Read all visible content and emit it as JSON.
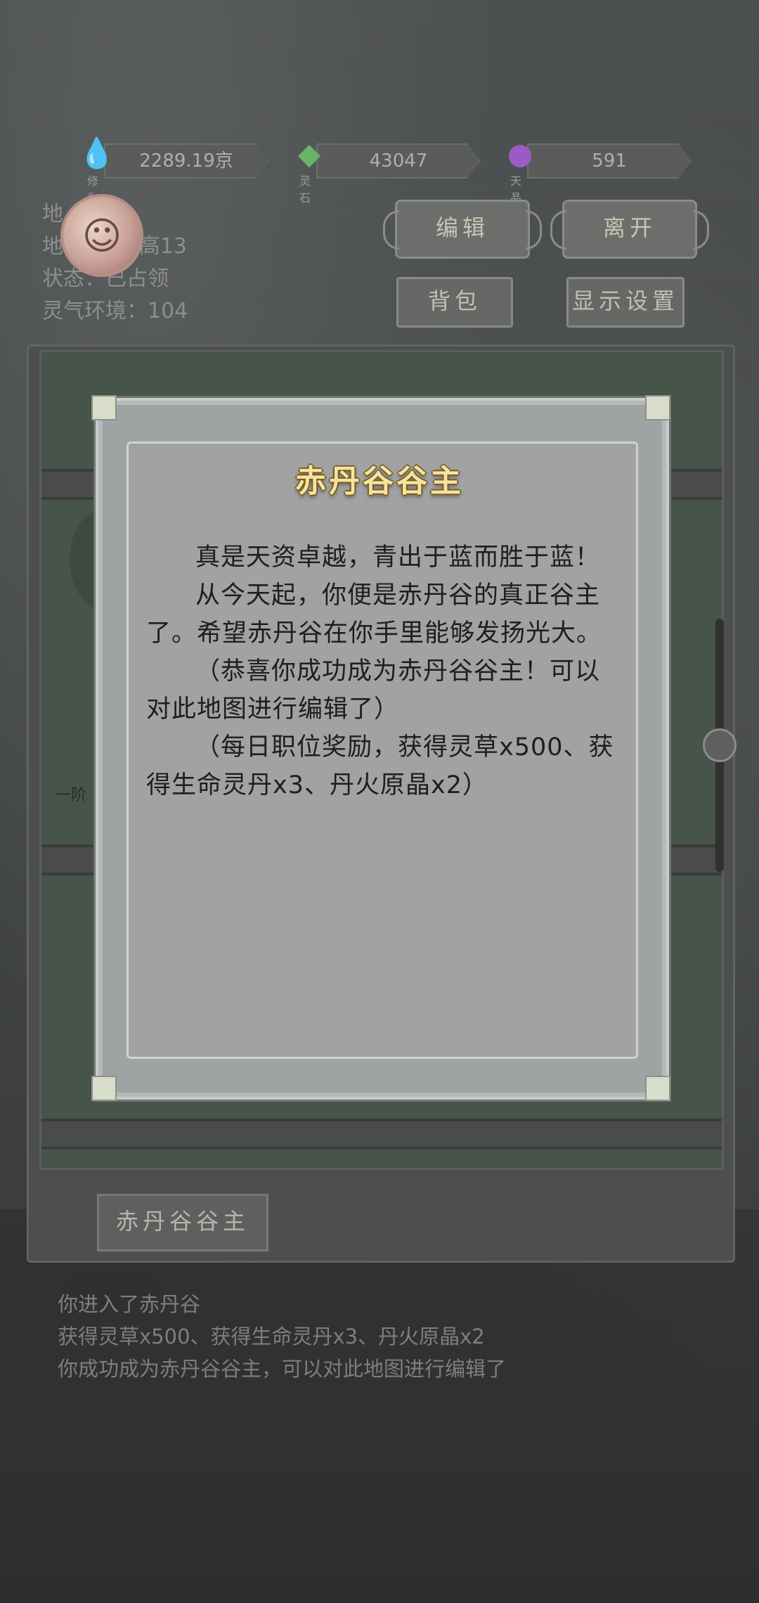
{
  "resources": [
    {
      "icon": "water-drop-icon",
      "label": "修为",
      "value": "2289.19京",
      "color": "#3aa7d8"
    },
    {
      "icon": "crystal-icon",
      "label": "灵石",
      "value": "43047",
      "color": "#6bb36a"
    },
    {
      "icon": "gem-icon",
      "label": "天晶",
      "value": "591",
      "color": "#9b5bc7"
    }
  ],
  "info": {
    "name_line": "地    丹谷",
    "size_line": "地        宽12、高13",
    "status_line": "状态：已占领",
    "env_line": "灵气环境：104"
  },
  "buttons": {
    "edit": "编辑",
    "leave": "离开",
    "bag": "背包",
    "display": "显示设置"
  },
  "tab": {
    "label": "赤丹谷谷主"
  },
  "modal": {
    "title": "赤丹谷谷主",
    "paragraphs": [
      "真是天资卓越，青出于蓝而胜于蓝！",
      "从今天起，你便是赤丹谷的真正谷主了。希望赤丹谷在你手里能够发扬光大。",
      "（恭喜你成功成为赤丹谷谷主！可以对此地图进行编辑了）",
      "（每日职位奖励，获得灵草x500、获得生命灵丹x3、丹火原晶x2）"
    ]
  },
  "log": [
    "你进入了赤丹谷",
    "获得灵草x500、获得生命灵丹x3、丹火原晶x2",
    "你成功成为赤丹谷谷主，可以对此地图进行编辑了"
  ],
  "map": {
    "node_label": "一阶"
  }
}
